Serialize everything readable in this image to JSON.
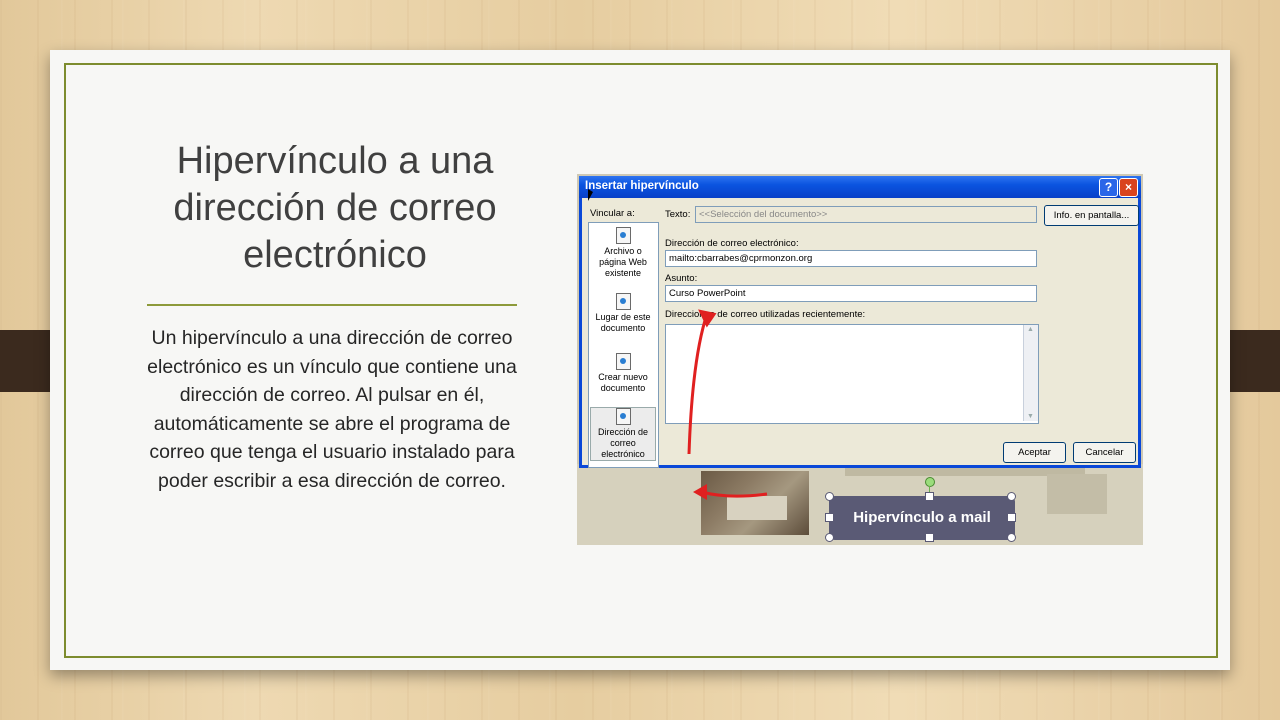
{
  "slide": {
    "title": "Hipervínculo a una dirección de correo electrónico",
    "body": "Un hipervínculo a una dirección de correo electrónico es un vínculo que contiene una dirección de correo. Al pulsar en él, automáticamente se abre el programa de correo que tenga el usuario instalado para poder escribir a esa dirección de correo."
  },
  "dialog": {
    "title": "Insertar hipervínculo",
    "help_icon": "?",
    "close_icon": "×",
    "link_to_label": "Vincular a:",
    "link_options": [
      {
        "label": "Archivo o página Web existente",
        "icon": "web-page-icon"
      },
      {
        "label": "Lugar de este documento",
        "icon": "document-place-icon"
      },
      {
        "label": "Crear nuevo documento",
        "icon": "new-document-icon"
      },
      {
        "label": "Dirección de correo electrónico",
        "icon": "email-icon"
      }
    ],
    "text_label": "Texto:",
    "text_value": "<<Selección del documento>>",
    "screentip_button": "Info. en pantalla...",
    "email_label": "Dirección de correo electrónico:",
    "email_value": "mailto:cbarrabes@cprmonzon.org",
    "subject_label": "Asunto:",
    "subject_value": "Curso PowerPoint",
    "recent_label": "Direcciones de correo utilizadas recientemente:",
    "ok_button": "Aceptar",
    "cancel_button": "Cancelar"
  },
  "background_shape": {
    "label": "Hipervínculo a mail"
  },
  "colors": {
    "frame_border": "#7d8c2e",
    "titlebar": "#0b54e0",
    "arrow": "#e02020"
  }
}
